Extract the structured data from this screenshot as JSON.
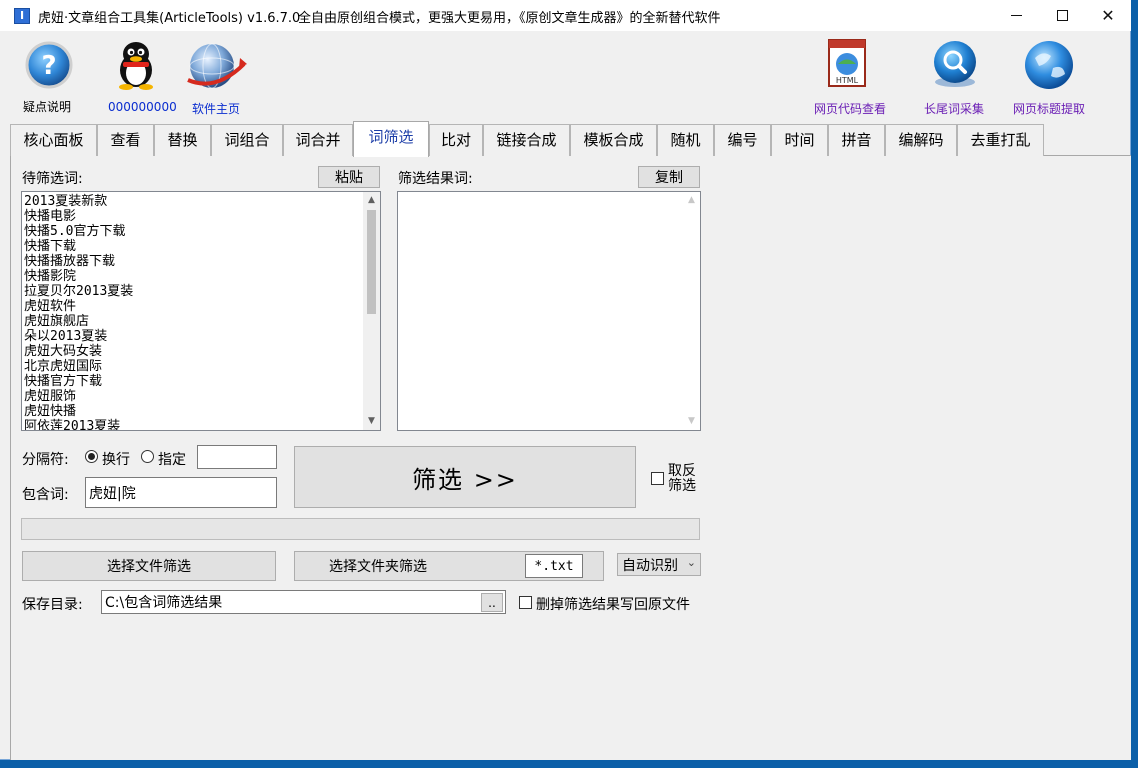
{
  "window": {
    "title": "虎妞·文章组合工具集(ArticleTools) v1.6.7.0",
    "slogan": "全自由原创组合模式，更强大更易用，《原创文章生成器》的全新替代软件",
    "app_icon_glyph": "I"
  },
  "toolbar": {
    "help_label": "疑点说明",
    "qq_label": "000000000",
    "home_label": "软件主页",
    "html_view_label": "网页代码查看",
    "longtail_label": "长尾词采集",
    "page_title_label": "网页标题提取",
    "html_badge": "HTML"
  },
  "tabs": [
    "核心面板",
    "查看",
    "替换",
    "词组合",
    "词合并",
    "词筛选",
    "比对",
    "链接合成",
    "模板合成",
    "随机",
    "编号",
    "时间",
    "拼音",
    "编解码",
    "去重打乱"
  ],
  "active_tab": "词筛选",
  "filter": {
    "source_label": "待筛选词:",
    "paste_button": "粘贴",
    "result_label": "筛选结果词:",
    "copy_button": "复制",
    "source_items": [
      "2013夏装新款",
      "快播电影",
      "快播5.0官方下载",
      "快播下载",
      "快播播放器下载",
      "快播影院",
      "拉夏贝尔2013夏装",
      "虎妞软件",
      "虎妞旗舰店",
      "朵以2013夏装",
      "虎妞大码女装",
      "北京虎妞国际",
      "快播官方下载",
      "虎妞服饰",
      "虎妞快播",
      "阿依莲2013夏装"
    ],
    "result_items": [],
    "separator_label": "分隔符:",
    "radio_newline": "换行",
    "radio_custom": "指定",
    "custom_separator_value": "",
    "include_label": "包含词:",
    "include_value": "虎妞|院",
    "filter_button": "筛选 >>",
    "invert_label_1": "取反",
    "invert_label_2": "筛选",
    "progress": 0,
    "choose_file_button": "选择文件筛选",
    "choose_folder_button": "选择文件夹筛选",
    "ext_value": "*.txt",
    "encoding_select": "自动识别",
    "save_dir_label": "保存目录:",
    "save_dir_value": "C:\\包含词筛选结果",
    "browse_button": "..",
    "delete_writeback_label": "删掉筛选结果写回原文件"
  }
}
